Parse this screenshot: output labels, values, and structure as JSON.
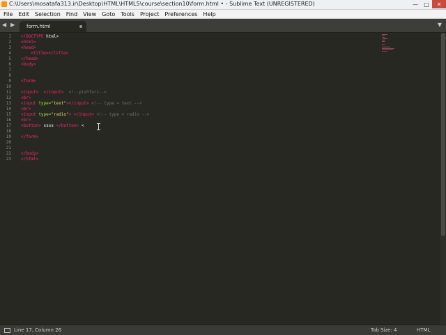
{
  "window": {
    "title": "C:\\Users\\mosatafa313.ir\\Desktop\\HTML\\HTML5\\course\\section10\\form.html • - Sublime Text (UNREGISTERED)",
    "minimize": "—",
    "maximize": "□",
    "close": "✕"
  },
  "menu": {
    "items": [
      "File",
      "Edit",
      "Selection",
      "Find",
      "View",
      "Goto",
      "Tools",
      "Project",
      "Preferences",
      "Help"
    ]
  },
  "tabs": {
    "nav_back": "◀",
    "nav_forward": "▶",
    "active_label": "form.html",
    "dropdown": "▼"
  },
  "editor": {
    "line_numbers": [
      "1",
      "2",
      "3",
      "4",
      "5",
      "6",
      "7",
      "8",
      "9",
      "10",
      "11",
      "12",
      "13",
      "14",
      "15",
      "16",
      "17",
      "18",
      "19",
      "20",
      "21",
      "22",
      "23"
    ],
    "code": {
      "l1_tag": "<!DOCTYPE",
      "l1_rest": " html>",
      "l2": "<html>",
      "l3": "<head>",
      "l4": "<title></title>",
      "l5": "</head>",
      "l6": "<body>",
      "l9": "<form>",
      "l11_tag": "<input>",
      "l11_close": "</input>",
      "l11_comment": "<!--pishfarz-->",
      "l12": "<br>",
      "l13_open": "<input",
      "l13_attr": "type=",
      "l13_val": "\"text\"",
      "l13_close": "></input>",
      "l13_comment": "<!-- type = text -->",
      "l14": "<br>",
      "l15_open": "<input",
      "l15_attr": "type=",
      "l15_val": "\"radio\"",
      "l15_mid": "> ",
      "l15_close": "</input>",
      "l15_comment": "<!-- type = radio -->",
      "l16": "<br>",
      "l17_open": "<button>",
      "l17_text": " ssss ",
      "l17_close": "</button>",
      "l17_rest": " <",
      "l19": "</form>",
      "l22": "</body>",
      "l23": "</html>"
    }
  },
  "status": {
    "position": "Line 17, Column 26",
    "tab_size": "Tab Size: 4",
    "syntax": "HTML"
  },
  "colors": {
    "background": "#272822",
    "tag": "#f92672",
    "attribute": "#a6e22e",
    "string": "#e6db74",
    "comment": "#75715e"
  }
}
